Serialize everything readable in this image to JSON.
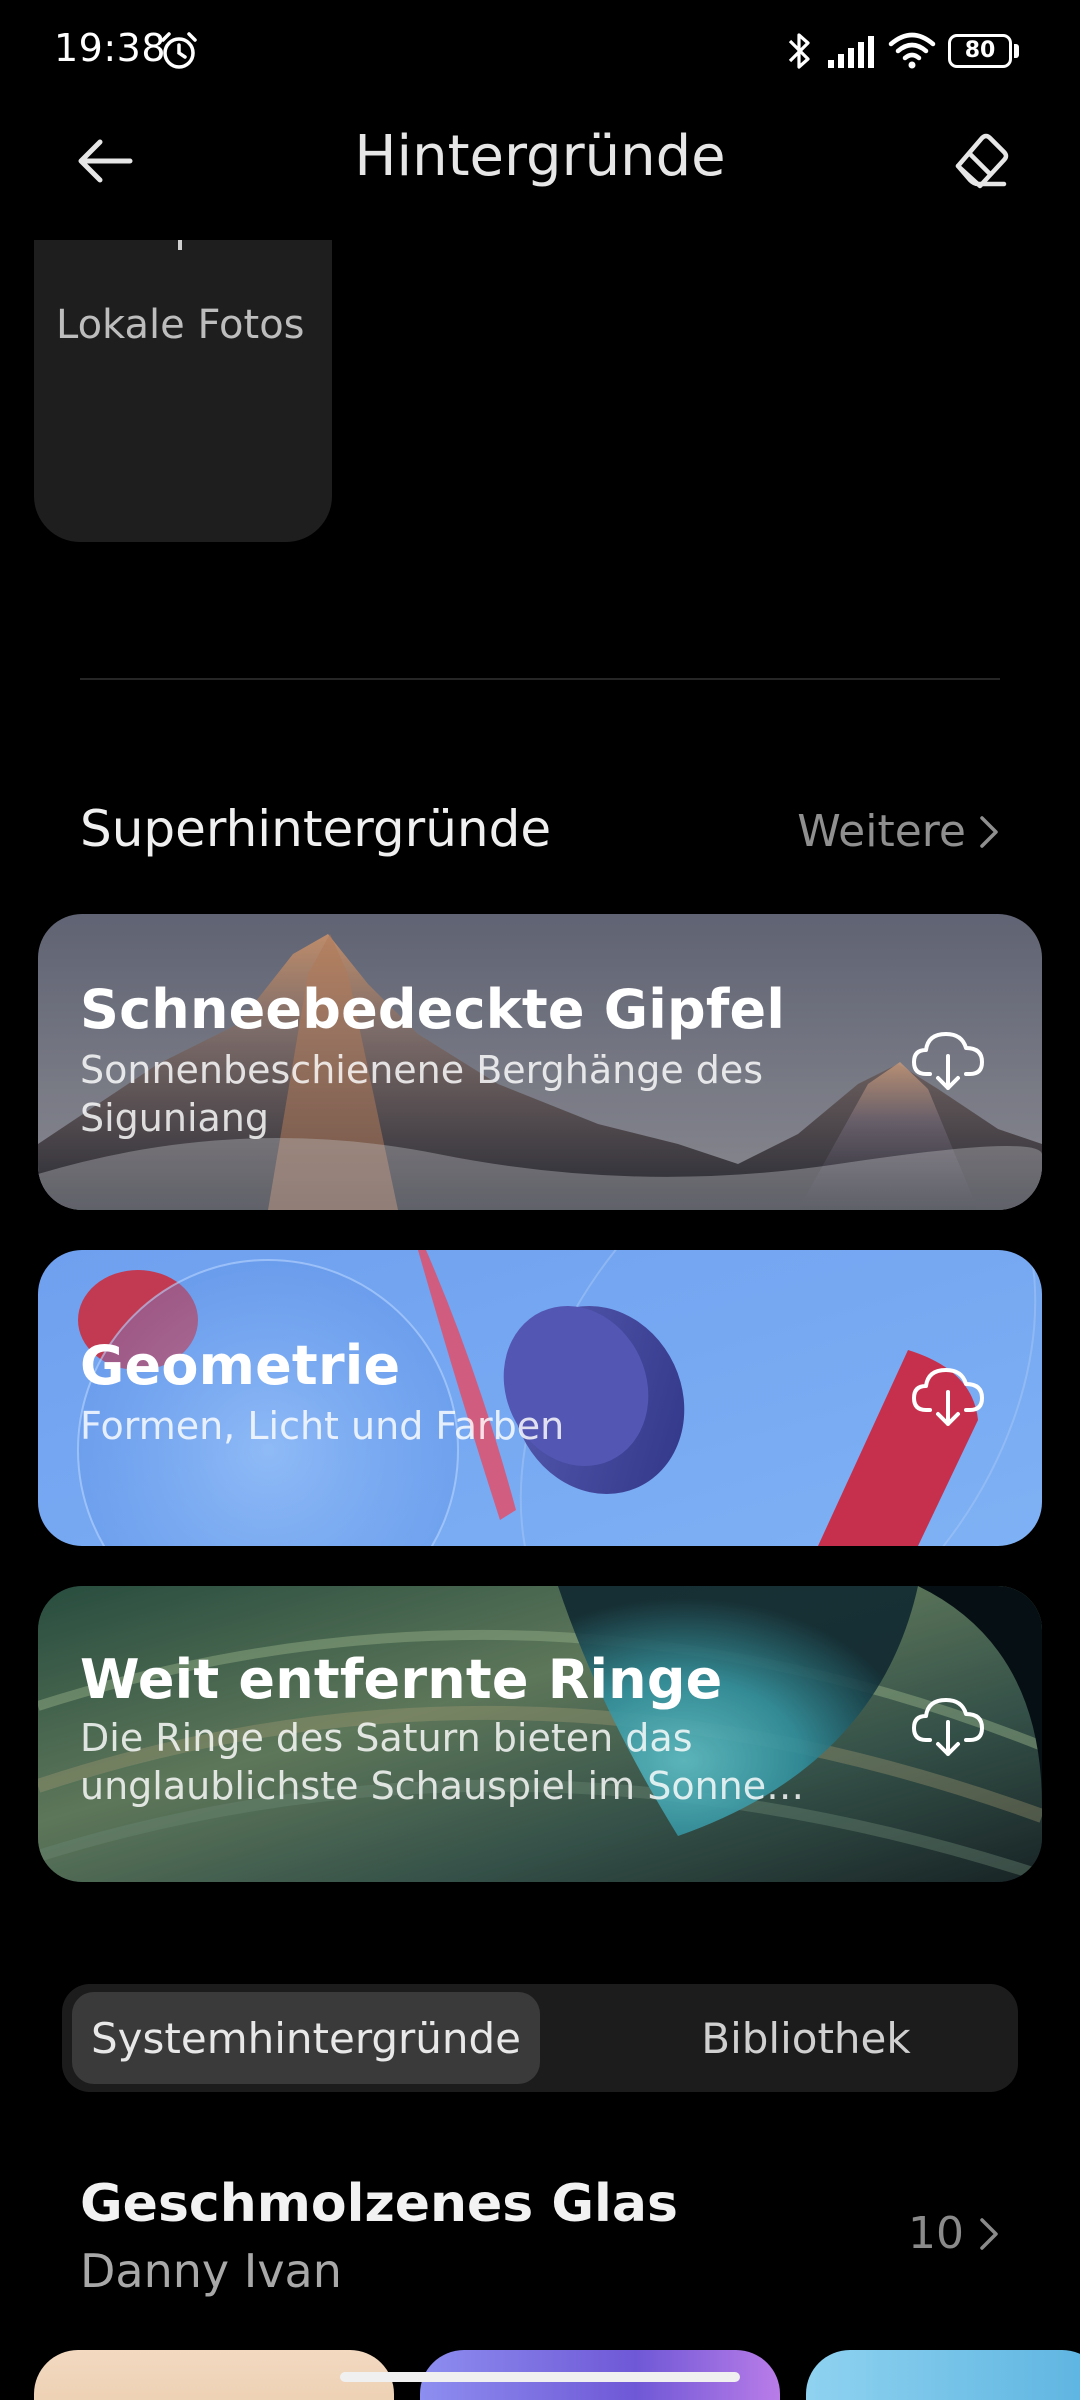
{
  "status_bar": {
    "time": "19:38",
    "battery": "80",
    "icons": [
      "alarm-icon",
      "bluetooth-icon",
      "signal-icon",
      "wifi-icon",
      "battery-icon"
    ]
  },
  "header": {
    "title": "Hintergründe",
    "back_icon": "back-arrow-icon",
    "edit_icon": "eraser-icon"
  },
  "local_tile": {
    "label": "Lokale Fotos"
  },
  "super_section": {
    "title": "Superhintergründe",
    "more_label": "Weitere",
    "cards": [
      {
        "title": "Schneebedeckte Gipfel",
        "subtitle": "Sonnenbeschienene Berghänge des Siguniang",
        "action_icon": "cloud-download-icon"
      },
      {
        "title": "Geometrie",
        "subtitle": "Formen, Licht und Farben",
        "action_icon": "cloud-download-icon"
      },
      {
        "title": "Weit entfernte Ringe",
        "subtitle": "Die Ringe des Saturn bieten das unglaublichste Schauspiel im Sonne…",
        "action_icon": "cloud-download-icon"
      }
    ]
  },
  "tabs": {
    "active": "Systemhintergründe",
    "inactive": "Bibliothek"
  },
  "collection": {
    "title": "Geschmolzenes Glas",
    "author": "Danny Ivan",
    "count": "10"
  },
  "colors": {
    "background": "#000000",
    "tile": "#1e1e1e",
    "segmented_bg": "#1c1c1c",
    "segmented_active": "#3a3a3a"
  }
}
